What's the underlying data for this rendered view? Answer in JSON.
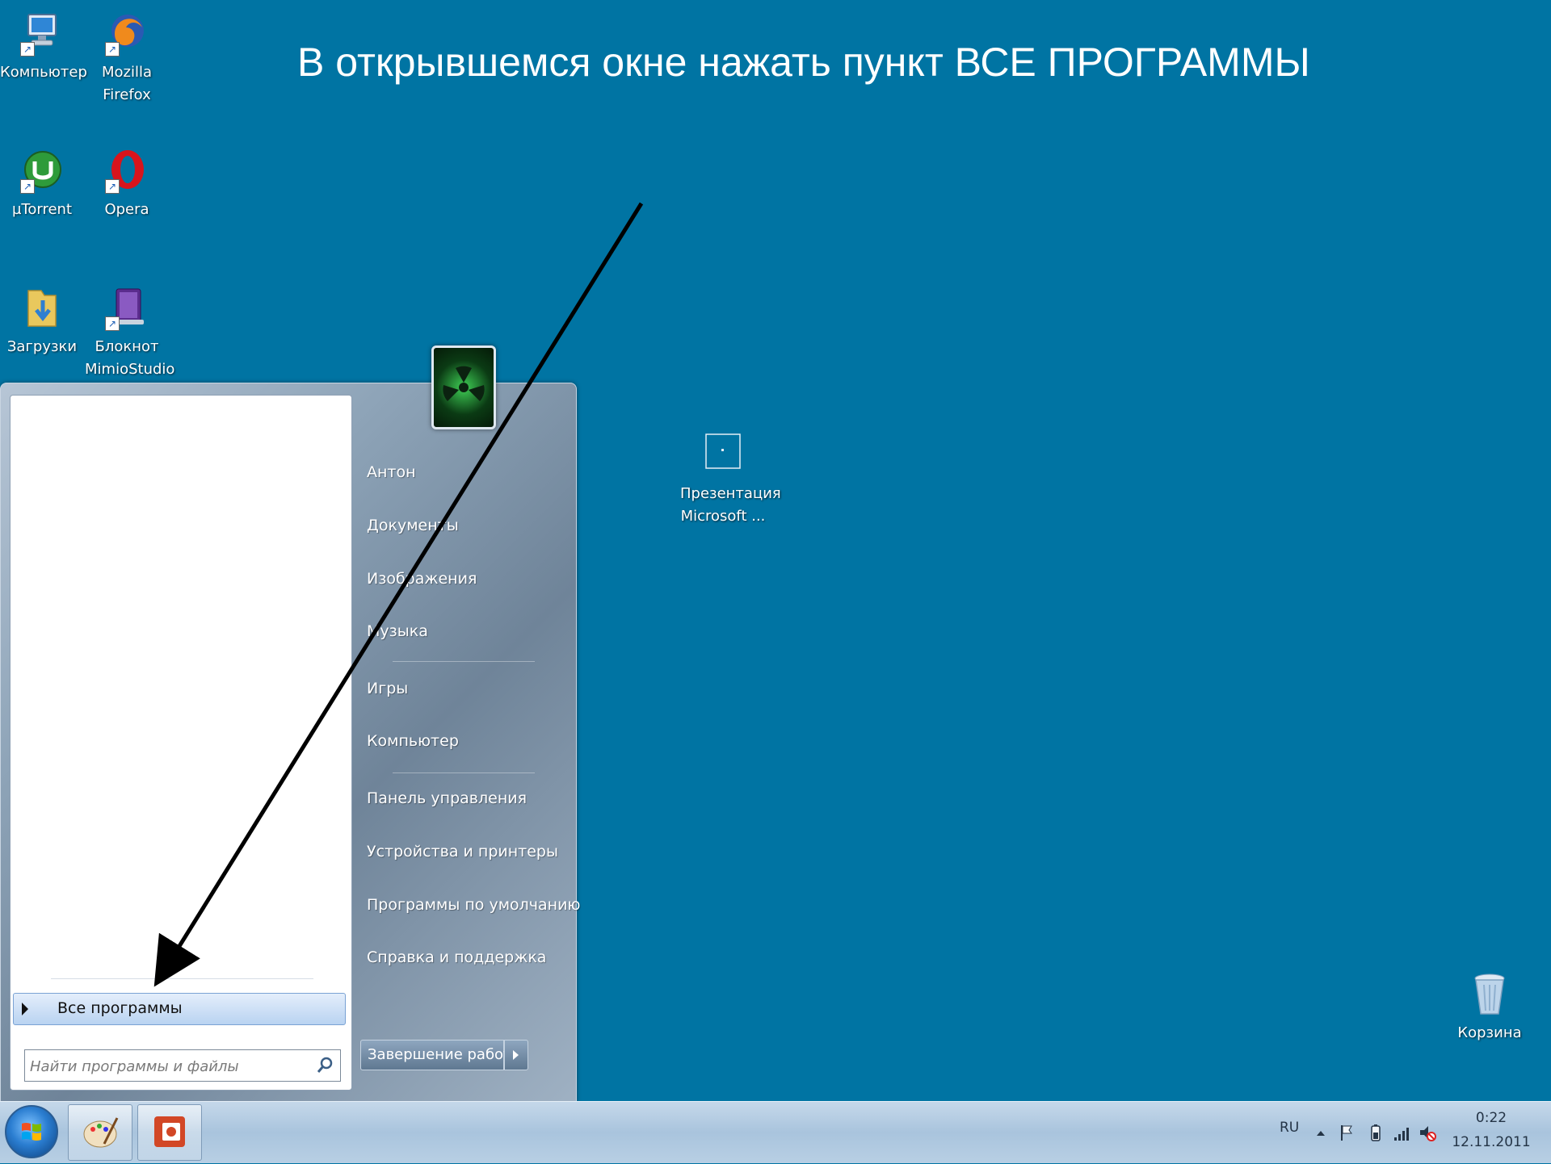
{
  "caption": "В открывшемся окне нажать  пункт ВСЕ ПРОГРАММЫ",
  "desktop_icons": {
    "computer": "Компьютер",
    "firefox_line1": "Mozilla",
    "firefox_line2": "Firefox",
    "utorrent": "µTorrent",
    "opera": "Opera",
    "downloads": "Загрузки",
    "notepad_line1": "Блокнот",
    "notepad_line2": "MimioStudio",
    "presentation_line1": "Презентация",
    "presentation_line2": "Microsoft ...",
    "recycle": "Корзина"
  },
  "start_menu": {
    "right_items": [
      "Антон",
      "Документы",
      "Изображения",
      "Музыка",
      "Игры",
      "Компьютер",
      "Панель управления",
      "Устройства и принтеры",
      "Программы по умолчанию",
      "Справка и поддержка"
    ],
    "all_programs": "Все программы",
    "search_placeholder": "Найти программы и файлы",
    "shutdown": "Завершение работы"
  },
  "taskbar": {
    "language": "RU",
    "time": "0:22",
    "date": "12.11.2011"
  },
  "colors": {
    "desktop": "#0074a3",
    "taskbar": "#b8cfe4"
  }
}
